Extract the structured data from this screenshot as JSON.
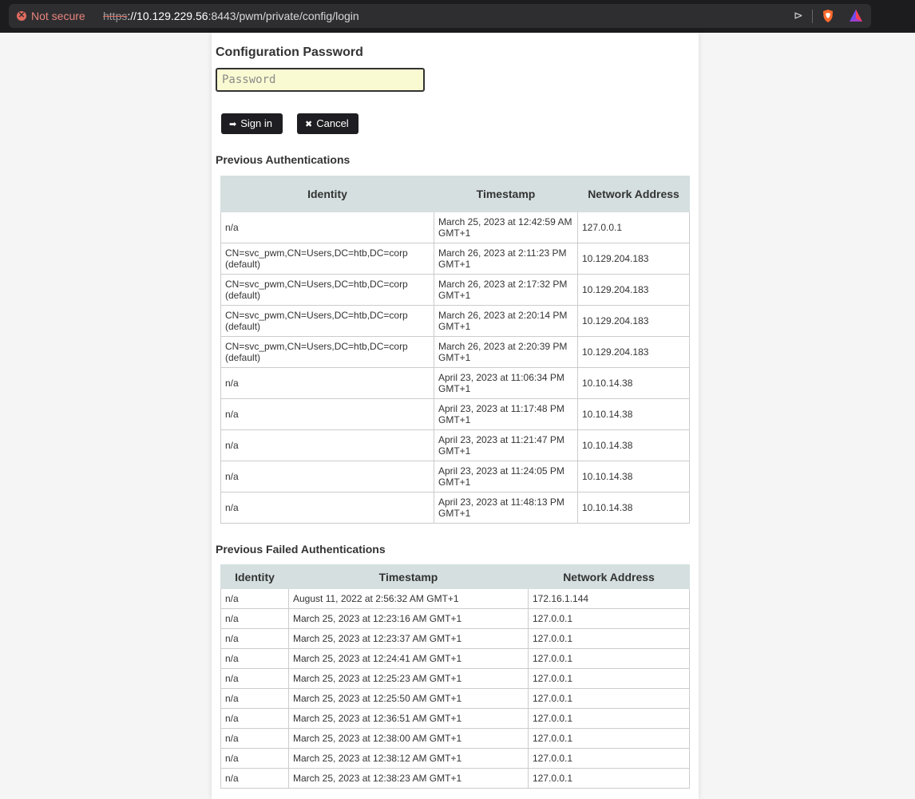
{
  "browser": {
    "security_label": "Not secure",
    "url_scheme": "https",
    "url_host": "://10.129.229.56",
    "url_rest": ":8443/pwm/private/config/login"
  },
  "login": {
    "heading": "Configuration Password",
    "password_placeholder": "Password",
    "signin_label": "Sign in",
    "cancel_label": "Cancel"
  },
  "previous_auth": {
    "heading": "Previous Authentications",
    "columns": [
      "Identity",
      "Timestamp",
      "Network Address"
    ],
    "rows": [
      {
        "identity": "n/a",
        "timestamp": "March 25, 2023 at 12:42:59 AM GMT+1",
        "address": "127.0.0.1"
      },
      {
        "identity": "CN=svc_pwm,CN=Users,DC=htb,DC=corp (default)",
        "timestamp": "March 26, 2023 at 2:11:23 PM GMT+1",
        "address": "10.129.204.183"
      },
      {
        "identity": "CN=svc_pwm,CN=Users,DC=htb,DC=corp (default)",
        "timestamp": "March 26, 2023 at 2:17:32 PM GMT+1",
        "address": "10.129.204.183"
      },
      {
        "identity": "CN=svc_pwm,CN=Users,DC=htb,DC=corp (default)",
        "timestamp": "March 26, 2023 at 2:20:14 PM GMT+1",
        "address": "10.129.204.183"
      },
      {
        "identity": "CN=svc_pwm,CN=Users,DC=htb,DC=corp (default)",
        "timestamp": "March 26, 2023 at 2:20:39 PM GMT+1",
        "address": "10.129.204.183"
      },
      {
        "identity": "n/a",
        "timestamp": "April 23, 2023 at 11:06:34 PM GMT+1",
        "address": "10.10.14.38"
      },
      {
        "identity": "n/a",
        "timestamp": "April 23, 2023 at 11:17:48 PM GMT+1",
        "address": "10.10.14.38"
      },
      {
        "identity": "n/a",
        "timestamp": "April 23, 2023 at 11:21:47 PM GMT+1",
        "address": "10.10.14.38"
      },
      {
        "identity": "n/a",
        "timestamp": "April 23, 2023 at 11:24:05 PM GMT+1",
        "address": "10.10.14.38"
      },
      {
        "identity": "n/a",
        "timestamp": "April 23, 2023 at 11:48:13 PM GMT+1",
        "address": "10.10.14.38"
      }
    ]
  },
  "failed_auth": {
    "heading": "Previous Failed Authentications",
    "columns": [
      "Identity",
      "Timestamp",
      "Network Address"
    ],
    "rows": [
      {
        "identity": "n/a",
        "timestamp": "August 11, 2022 at 2:56:32 AM GMT+1",
        "address": "172.16.1.144"
      },
      {
        "identity": "n/a",
        "timestamp": "March 25, 2023 at 12:23:16 AM GMT+1",
        "address": "127.0.0.1"
      },
      {
        "identity": "n/a",
        "timestamp": "March 25, 2023 at 12:23:37 AM GMT+1",
        "address": "127.0.0.1"
      },
      {
        "identity": "n/a",
        "timestamp": "March 25, 2023 at 12:24:41 AM GMT+1",
        "address": "127.0.0.1"
      },
      {
        "identity": "n/a",
        "timestamp": "March 25, 2023 at 12:25:23 AM GMT+1",
        "address": "127.0.0.1"
      },
      {
        "identity": "n/a",
        "timestamp": "March 25, 2023 at 12:25:50 AM GMT+1",
        "address": "127.0.0.1"
      },
      {
        "identity": "n/a",
        "timestamp": "March 25, 2023 at 12:36:51 AM GMT+1",
        "address": "127.0.0.1"
      },
      {
        "identity": "n/a",
        "timestamp": "March 25, 2023 at 12:38:00 AM GMT+1",
        "address": "127.0.0.1"
      },
      {
        "identity": "n/a",
        "timestamp": "March 25, 2023 at 12:38:12 AM GMT+1",
        "address": "127.0.0.1"
      },
      {
        "identity": "n/a",
        "timestamp": "March 25, 2023 at 12:38:23 AM GMT+1",
        "address": "127.0.0.1"
      }
    ]
  }
}
